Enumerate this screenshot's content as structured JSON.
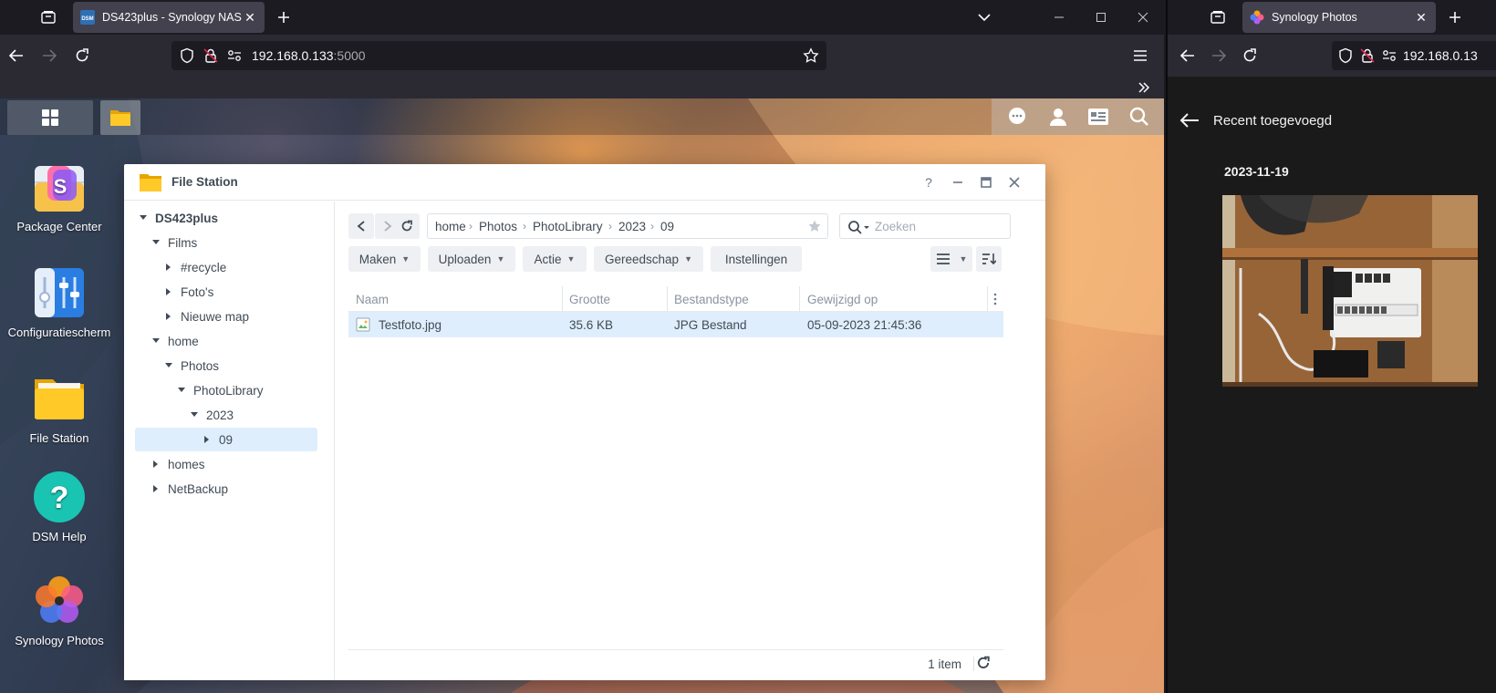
{
  "left_browser": {
    "tab_title": "DS423plus - Synology NAS",
    "favicon_text": "DSM",
    "url_host": "192.168.0.133",
    "url_port": ":5000"
  },
  "right_browser": {
    "tab_title": "Synology Photos",
    "url_host": "192.168.0.13"
  },
  "desktop": {
    "icons": [
      {
        "label": "Package Center"
      },
      {
        "label": "Configuratiescherm"
      },
      {
        "label": "File Station"
      },
      {
        "label": "DSM Help"
      },
      {
        "label": "Synology Photos"
      }
    ]
  },
  "file_station": {
    "title": "File Station",
    "tree": {
      "root": "DS423plus",
      "films": "Films",
      "recycle": "#recycle",
      "fotos": "Foto's",
      "nieuwe_map": "Nieuwe map",
      "home": "home",
      "photos": "Photos",
      "photolibrary": "PhotoLibrary",
      "year": "2023",
      "month": "09",
      "homes": "homes",
      "netbackup": "NetBackup"
    },
    "path": [
      "home",
      "Photos",
      "PhotoLibrary",
      "2023",
      "09"
    ],
    "search_placeholder": "Zoeken",
    "toolbar": {
      "maken": "Maken",
      "uploaden": "Uploaden",
      "actie": "Actie",
      "gereedschap": "Gereedschap",
      "instellingen": "Instellingen"
    },
    "columns": {
      "name": "Naam",
      "size": "Grootte",
      "type": "Bestandstype",
      "modified": "Gewijzigd op"
    },
    "files": [
      {
        "name": "Testfoto.jpg",
        "size": "35.6 KB",
        "type": "JPG Bestand",
        "modified": "05-09-2023 21:45:36"
      }
    ],
    "status_count": "1 item"
  },
  "photos_app": {
    "header_title": "Recent toegevoegd",
    "date_group": "2023-11-19"
  },
  "colors": {
    "browser_bg": "#1c1b22",
    "toolbar_bg": "#2b2a33",
    "tab_active": "#42414d",
    "selection": "#dfeefc",
    "dsm_text": "#414b55"
  }
}
